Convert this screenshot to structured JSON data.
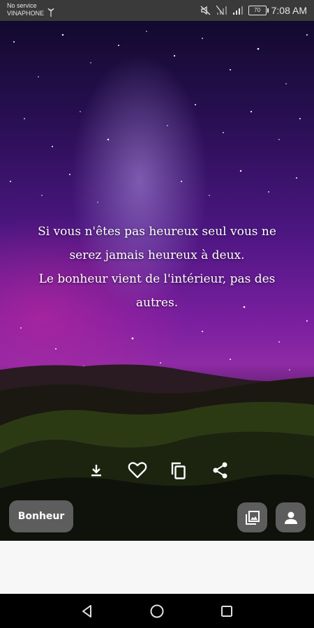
{
  "status_bar": {
    "carrier_line1": "No service",
    "carrier_line2": "VINAPHONE",
    "battery": "70",
    "time": "7:08 AM"
  },
  "quote": {
    "text": "Si vous n'êtes pas heureux seul vous ne\nserez jamais heureux à deux.\nLe bonheur vient de l'intérieur, pas des\nautres."
  },
  "actions": {
    "download_icon": "download-icon",
    "like_icon": "heart-outline-icon",
    "copy_icon": "copy-icon",
    "share_icon": "share-icon"
  },
  "category": {
    "label": "Bonheur"
  },
  "buttons": {
    "gallery_icon": "gallery-icon",
    "profile_icon": "person-icon"
  },
  "colors": {
    "status_bar_bg": "#3a3a3a",
    "chip_bg": "#5d5d5d",
    "bottom_area_bg": "#f7f7f7",
    "nav_bar_bg": "#000000"
  }
}
